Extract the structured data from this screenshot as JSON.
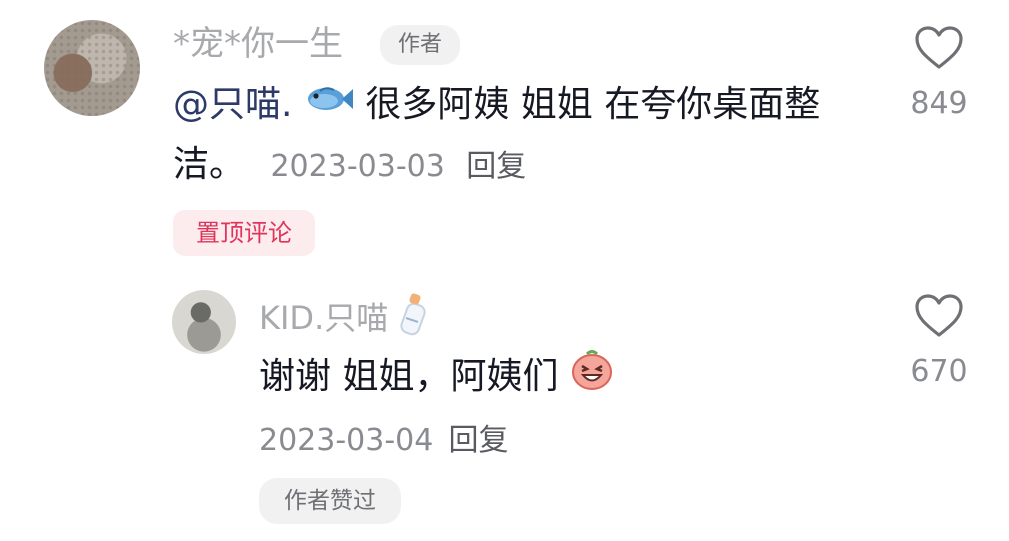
{
  "comment": {
    "username": "*宠*你一生",
    "author_badge": "作者",
    "mention": "@只喵.",
    "text_line1": "很多阿姨 姐姐 在夸你桌面整",
    "text_line2": "洁。",
    "date": "2023-03-03",
    "reply_label": "回复",
    "pinned_label": "置顶评论",
    "likes": "849",
    "mention_emoji": "fish-emoji"
  },
  "reply": {
    "username": "KID.只喵",
    "username_emoji": "baby-bottle-emoji",
    "text": "谢谢 姐姐，阿姨们",
    "text_emoji": "laughing-face-emoji",
    "date": "2023-03-04",
    "reply_label": "回复",
    "liked_by_author_label": "作者赞过",
    "likes": "670"
  },
  "colors": {
    "pinned_text": "#e0355a",
    "pinned_bg": "#fcecee",
    "mention": "#2b3a67",
    "muted": "#a8a9ad"
  }
}
